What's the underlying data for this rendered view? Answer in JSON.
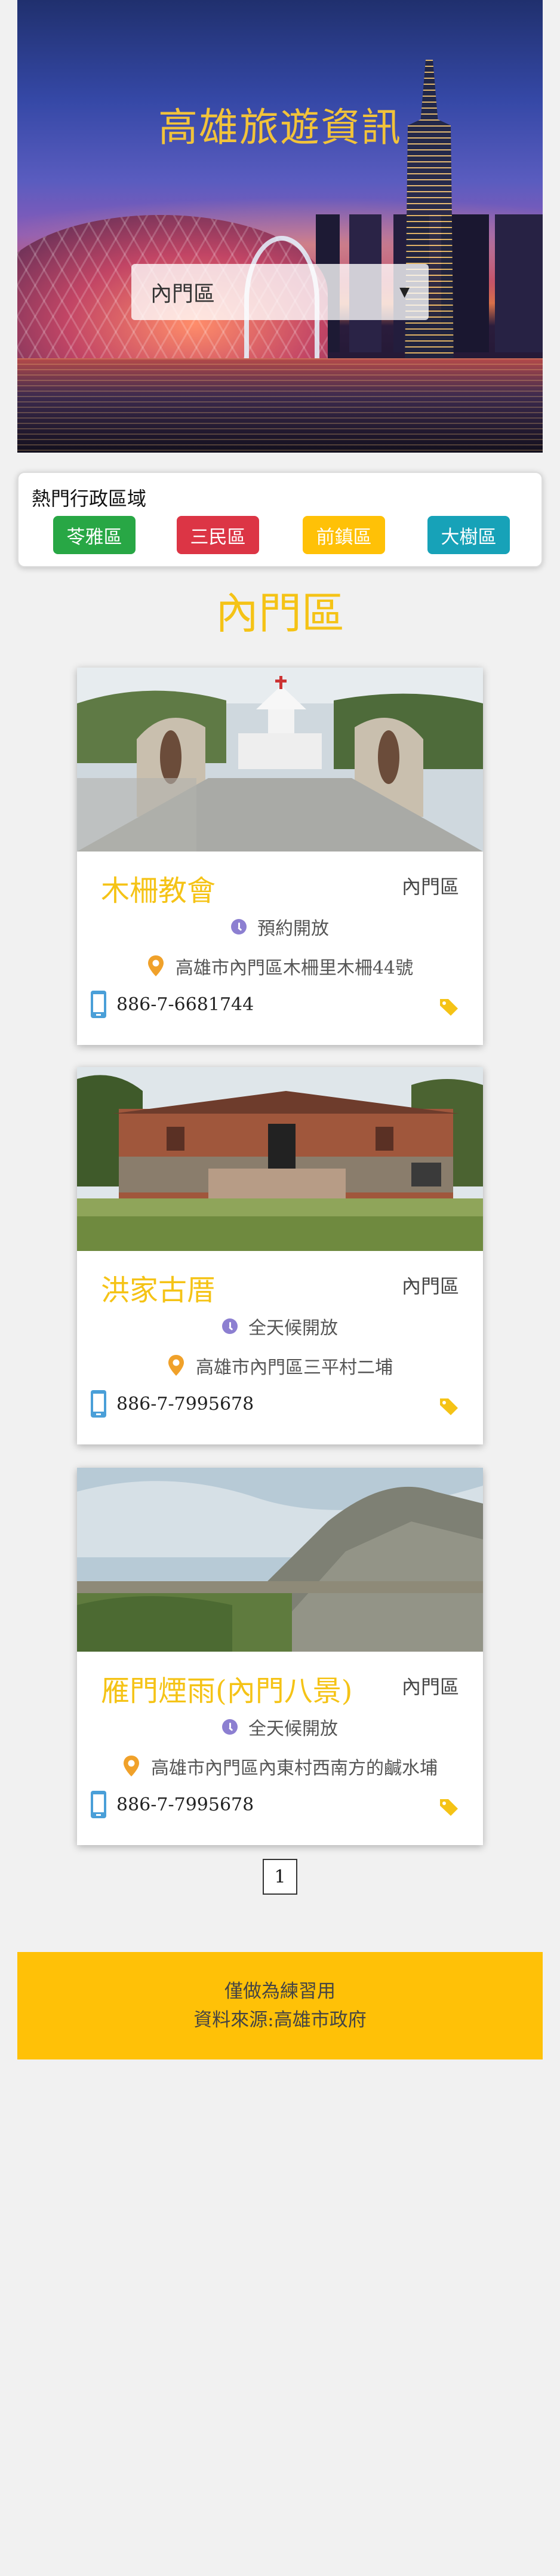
{
  "header": {
    "title": "高雄旅遊資訊",
    "district_select": {
      "value": "內門區"
    }
  },
  "hot_districts": {
    "title": "熱門行政區域",
    "items": [
      {
        "label": "苓雅區",
        "color": "#28a745"
      },
      {
        "label": "三民區",
        "color": "#dc3545"
      },
      {
        "label": "前鎮區",
        "color": "#ffc107"
      },
      {
        "label": "大樹區",
        "color": "#17a2b8"
      }
    ]
  },
  "results": {
    "district_heading": "內門區",
    "cards": [
      {
        "name": "木柵教會",
        "zone": "內門區",
        "open": "預約開放",
        "address": "高雄市內門區木柵里木柵44號",
        "phone": "886-7-6681744",
        "image": "church-photo"
      },
      {
        "name": "洪家古厝",
        "zone": "內門區",
        "open": "全天候開放",
        "address": "高雄市內門區三平村二埔",
        "phone": "886-7-7995678",
        "image": "old-house-photo"
      },
      {
        "name": "雁門煙雨(內門八景)",
        "zone": "內門區",
        "open": "全天候開放",
        "address": "高雄市內門區內東村西南方的鹹水埔",
        "phone": "886-7-7995678",
        "image": "mudstone-hills-photo"
      }
    ]
  },
  "pagination": {
    "current": "1"
  },
  "footer": {
    "line1": "僅做為練習用",
    "line2": "資料來源:高雄市政府"
  },
  "colors": {
    "accent": "#f5c316",
    "footer_bg": "#ffc107",
    "clock_icon": "#8c7fd1",
    "pin_icon": "#f0a12a",
    "phone_icon": "#4a9fd8",
    "tag_icon": "#f5c316"
  }
}
